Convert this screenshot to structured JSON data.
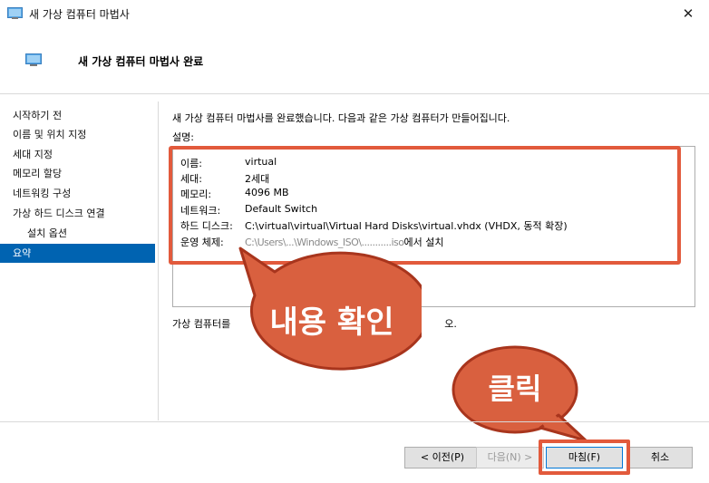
{
  "window": {
    "title": "새 가상 컴퓨터 마법사",
    "close_glyph": "✕"
  },
  "header": {
    "title": "새 가상 컴퓨터 마법사 완료"
  },
  "sidebar": {
    "items": [
      {
        "label": "시작하기 전"
      },
      {
        "label": "이름 및 위치 지정"
      },
      {
        "label": "세대 지정"
      },
      {
        "label": "메모리 할당"
      },
      {
        "label": "네트워킹 구성"
      },
      {
        "label": "가상 하드 디스크 연결"
      },
      {
        "label": "설치 옵션"
      },
      {
        "label": "요약"
      }
    ]
  },
  "main": {
    "intro": "새 가상 컴퓨터 마법사를 완료했습니다. 다음과 같은 가상 컴퓨터가 만들어집니다.",
    "desc_label": "설명:",
    "summary": [
      {
        "key": "이름:",
        "value": "virtual"
      },
      {
        "key": "세대:",
        "value": "2세대"
      },
      {
        "key": "메모리:",
        "value": "4096 MB"
      },
      {
        "key": "네트워크:",
        "value": "Default Switch"
      },
      {
        "key": "하드 디스크:",
        "value": "C:\\virtual\\virtual\\Virtual Hard Disks\\virtual.vhdx (VHDX, 동적 확장)"
      },
      {
        "key": "운영 체제:",
        "value_blurred": "C:\\Users\\...\\Windows_ISO\\...........iso",
        "value_suffix": "에서 설치"
      }
    ],
    "finish_hint_start": "가상 컴퓨터를",
    "finish_hint_end": "오."
  },
  "buttons": {
    "prev": "< 이전(P)",
    "next": "다음(N) >",
    "finish": "마침(F)",
    "cancel": "취소"
  },
  "annotations": {
    "bubble_check": "내용 확인",
    "bubble_click": "클릭"
  },
  "colors": {
    "accent": "#0063b1",
    "annotation": "#e25a3c",
    "bubble_fill": "#d9603f",
    "bubble_stroke": "#a8351d"
  }
}
